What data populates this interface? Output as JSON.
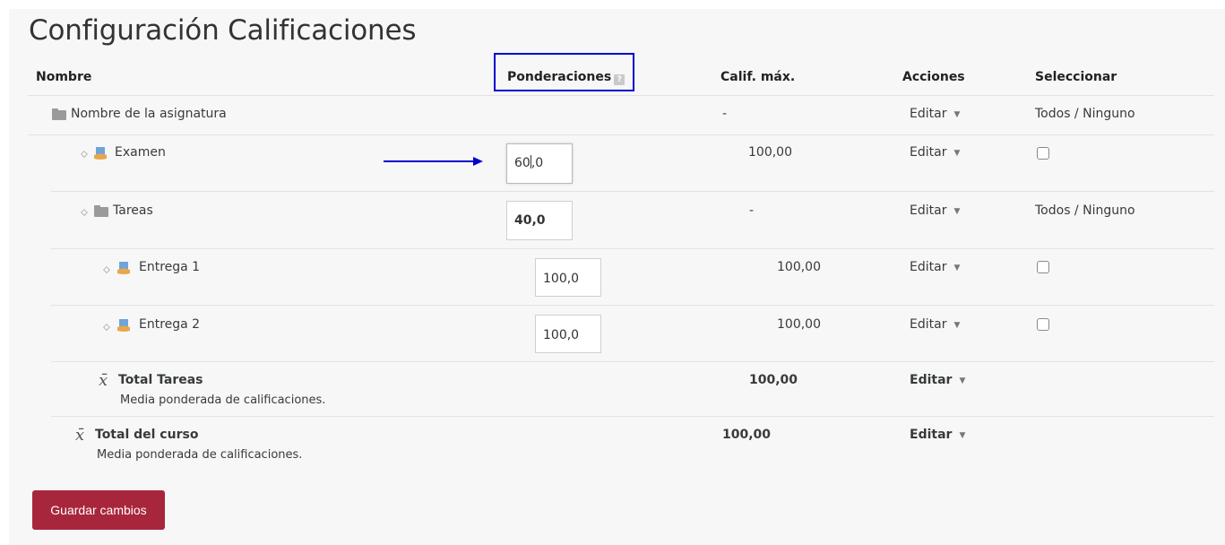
{
  "page": {
    "title": "Configuración Calificaciones"
  },
  "headers": {
    "name": "Nombre",
    "weights": "Ponderaciones",
    "max_grade": "Calif. máx.",
    "actions": "Acciones",
    "select": "Seleccionar"
  },
  "rows": {
    "course": {
      "name": "Nombre de la asignatura",
      "max": "-",
      "edit": "Editar",
      "select": "Todos / Ninguno"
    },
    "exam": {
      "name": "Examen",
      "weight": "60,0",
      "weight_before_caret": "60",
      "weight_after_caret": ",0",
      "max": "100,00",
      "edit": "Editar"
    },
    "tasks": {
      "name": "Tareas",
      "weight": "40,0",
      "max": "-",
      "edit": "Editar",
      "select": "Todos / Ninguno"
    },
    "entrega1": {
      "name": "Entrega 1",
      "weight": "100,0",
      "max": "100,00",
      "edit": "Editar"
    },
    "entrega2": {
      "name": "Entrega 2",
      "weight": "100,0",
      "max": "100,00",
      "edit": "Editar"
    },
    "total_tasks": {
      "name": "Total Tareas",
      "desc": "Media ponderada de calificaciones.",
      "max": "100,00",
      "edit": "Editar"
    },
    "total_course": {
      "name": "Total del curso",
      "desc": "Media ponderada de calificaciones.",
      "max": "100,00",
      "edit": "Editar"
    }
  },
  "icons": {
    "xbar": "x̄"
  },
  "colors": {
    "accent": "#a8263c",
    "highlight": "#0000cc",
    "arrow": "#0000cc"
  },
  "buttons": {
    "save": "Guardar cambios"
  }
}
